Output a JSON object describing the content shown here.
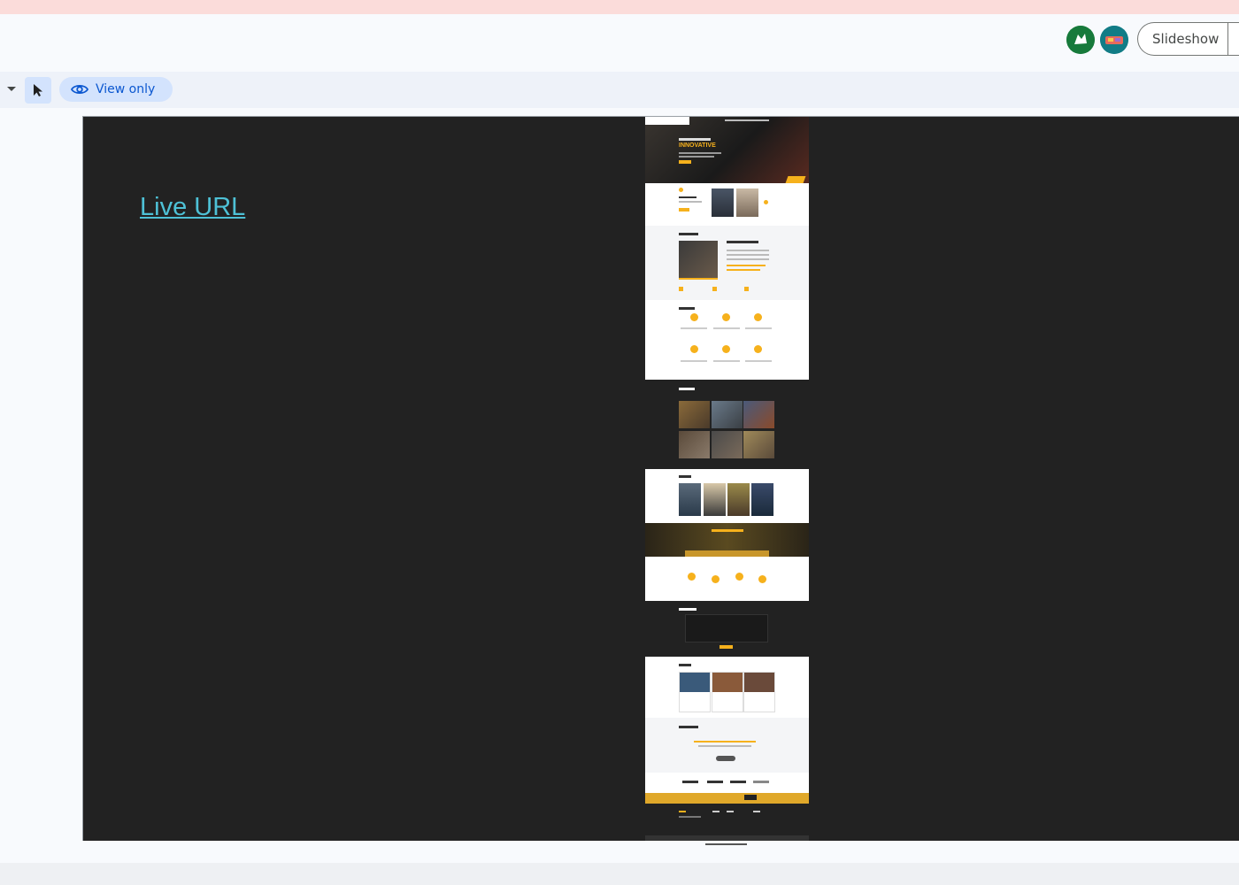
{
  "header": {
    "slideshow_label": "Slideshow",
    "avatars": [
      {
        "icon": "user-avatar-icon",
        "color": "#177a3b"
      },
      {
        "icon": "user-avatar-icon",
        "color": "#127c86"
      }
    ]
  },
  "toolbar": {
    "view_only_label": "View only",
    "icons": [
      "caret-down-icon",
      "select-pointer-icon",
      "eye-icon"
    ]
  },
  "slide": {
    "link_text": "Live URL",
    "link_color": "#4ec1d6",
    "background": "#222222",
    "thumbnail_heading": "INNOVATIVE"
  },
  "colors": {
    "accent": "#f6b11c",
    "toolbar_active": "#d3e3fd",
    "primary_text": "#0b57d0",
    "top_strip": "#fbdcda"
  }
}
